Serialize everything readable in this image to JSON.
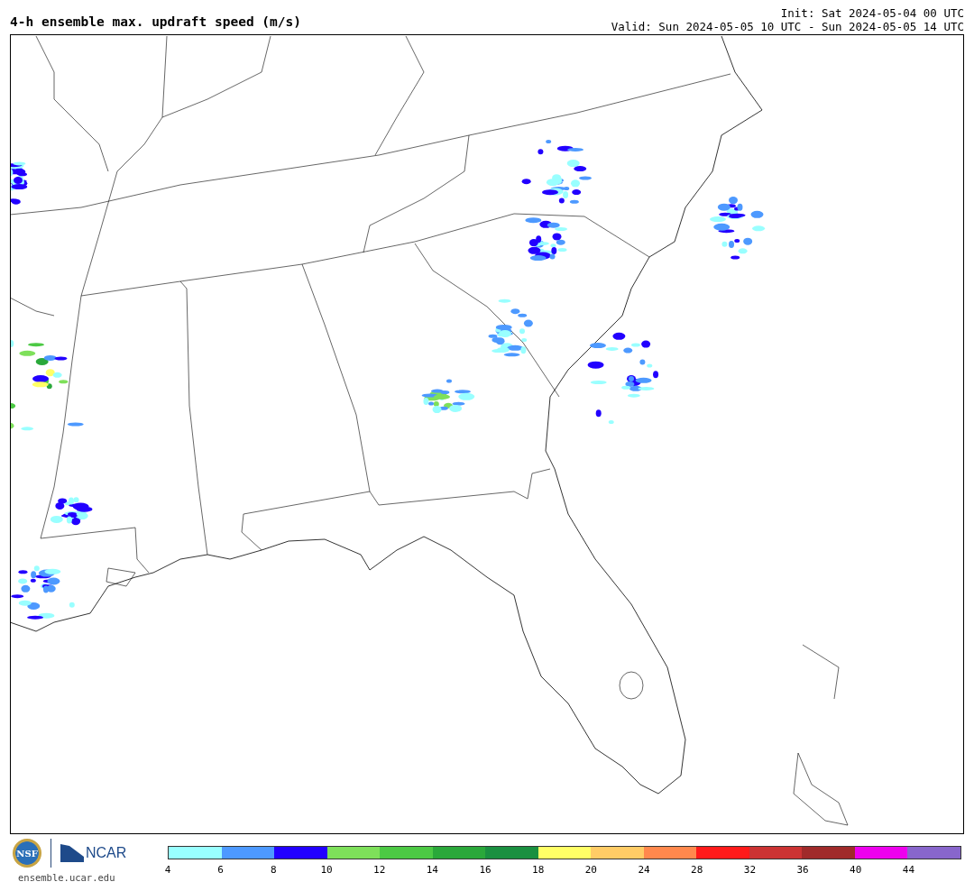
{
  "title": "4-h ensemble max. updraft speed (m/s)",
  "init": "Init: Sat 2024-05-04 00 UTC",
  "valid": "Valid: Sun 2024-05-05 10 UTC - Sun 2024-05-05 14 UTC",
  "footer": {
    "logo_nsf": "NSF",
    "logo_ncar": "NCAR",
    "url": "ensemble.ucar.edu"
  },
  "legend": [
    {
      "label": "4",
      "color": "#99ffff"
    },
    {
      "label": "6",
      "color": "#4d99ff"
    },
    {
      "label": "8",
      "color": "#2200ff"
    },
    {
      "label": "10",
      "color": "#7ee05a"
    },
    {
      "label": "12",
      "color": "#4cc944"
    },
    {
      "label": "14",
      "color": "#2aa83a"
    },
    {
      "label": "16",
      "color": "#1a9040"
    },
    {
      "label": "18",
      "color": "#ffff66"
    },
    {
      "label": "20",
      "color": "#ffcc66"
    },
    {
      "label": "24",
      "color": "#ff884d"
    },
    {
      "label": "28",
      "color": "#ff1a1a"
    },
    {
      "label": "32",
      "color": "#cc3333"
    },
    {
      "label": "36",
      "color": "#a02a2a"
    },
    {
      "label": "40",
      "color": "#ee00ee"
    },
    {
      "label": "44",
      "color": "#8866cc"
    }
  ]
}
